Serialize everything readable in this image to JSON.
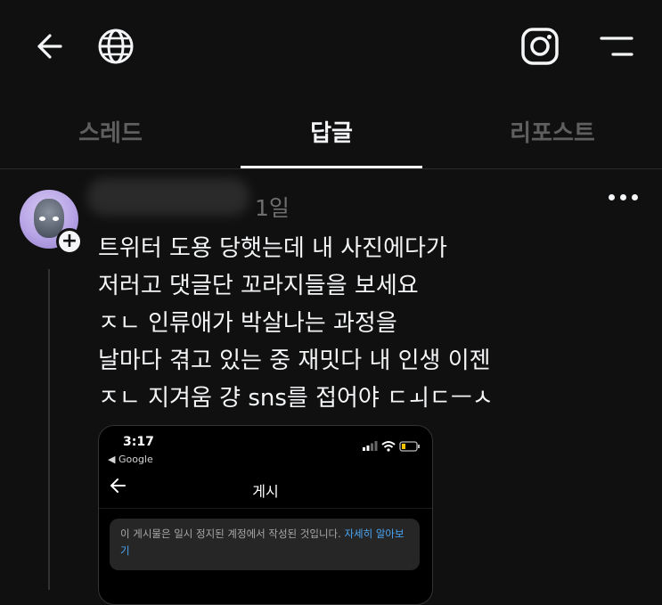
{
  "topbar": {
    "back_icon": "arrow-left-icon",
    "globe_icon": "globe-icon",
    "instagram_icon": "instagram-icon",
    "menu_icon": "menu-icon"
  },
  "tabs": [
    {
      "label": "스레드",
      "active": false
    },
    {
      "label": "답글",
      "active": true
    },
    {
      "label": "리포스트",
      "active": false
    }
  ],
  "post": {
    "time": "1일",
    "lines": [
      "트위터 도용 당햇는데 내 사진에다가",
      "저러고 댓글단 꼬라지들을 보세요",
      "ㅈㄴ 인류애가 박살나는 과정을",
      "날마다 겪고 있는 중 재밋다 내 인생 이젠",
      "ㅈㄴ 지겨움 걍 sns를 접어야 ㄷㅚㄷㅡㅅ"
    ],
    "screenshot": {
      "time": "3:17",
      "back_app": "◀ Google",
      "title": "게시",
      "notice_text": "이 게시물은 일시 정지된 계정에서 작성된 것입니다. ",
      "notice_link": "자세히 알아보기"
    }
  },
  "colors": {
    "background": "#101010",
    "text": "#f3f5f7",
    "inactive_tab": "#5f5f5f",
    "link": "#4aa6f5"
  }
}
